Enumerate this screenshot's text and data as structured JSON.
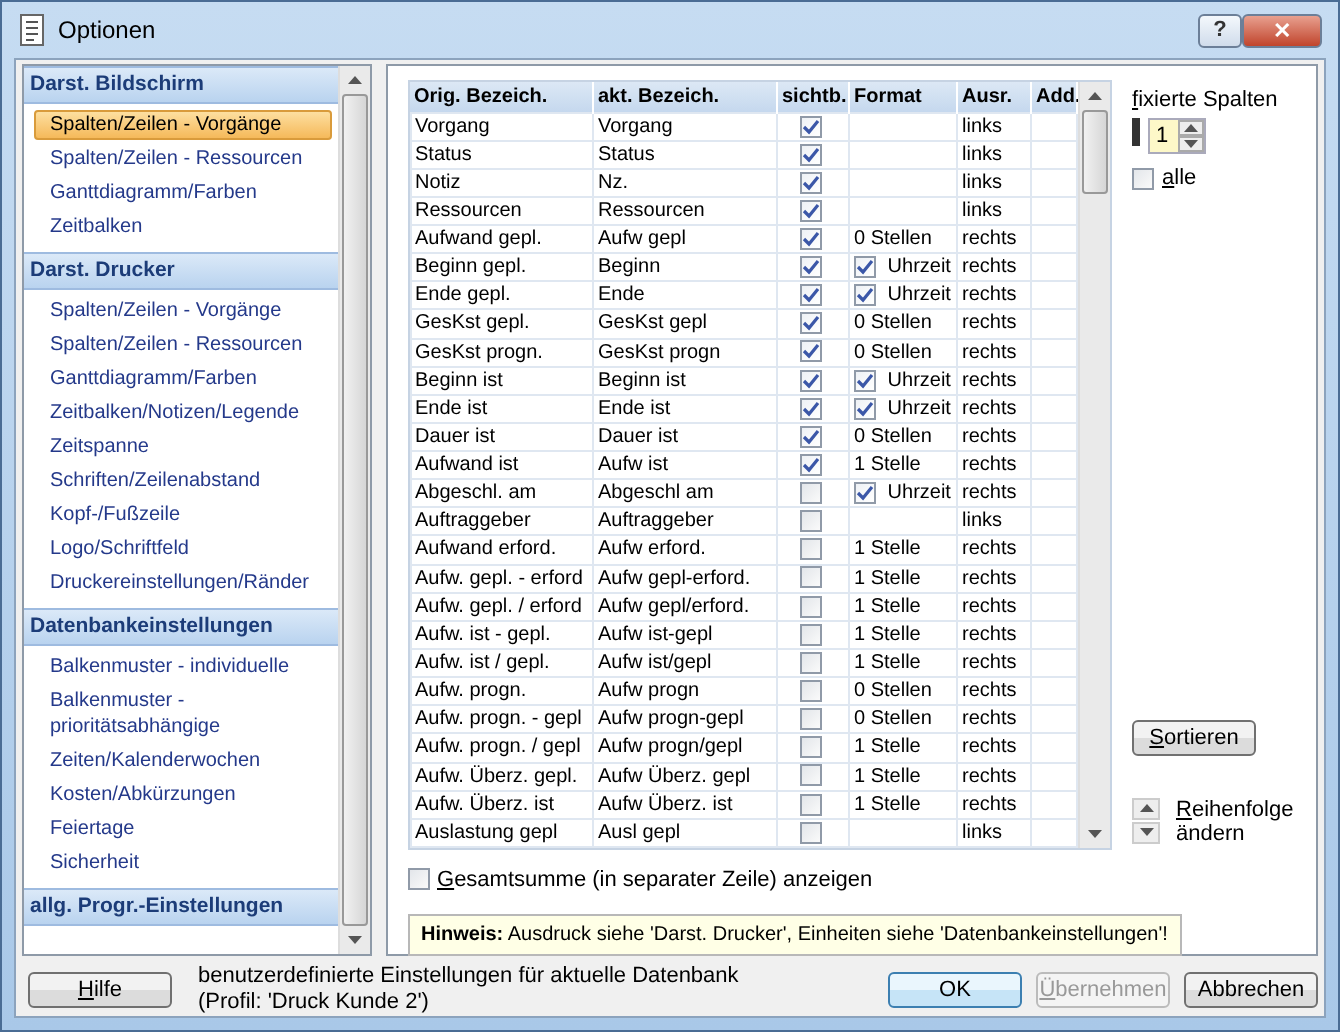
{
  "window": {
    "title": "Optionen",
    "help_button": "?",
    "close_button": "✕"
  },
  "sidebar": {
    "sections": [
      {
        "title": "Darst. Bildschirm",
        "items": [
          {
            "label": "Spalten/Zeilen - Vorgänge",
            "selected": true
          },
          {
            "label": "Spalten/Zeilen - Ressourcen",
            "selected": false
          },
          {
            "label": "Ganttdiagramm/Farben",
            "selected": false
          },
          {
            "label": "Zeitbalken",
            "selected": false
          }
        ]
      },
      {
        "title": "Darst. Drucker",
        "items": [
          {
            "label": "Spalten/Zeilen - Vorgänge",
            "selected": false
          },
          {
            "label": "Spalten/Zeilen - Ressourcen",
            "selected": false
          },
          {
            "label": "Ganttdiagramm/Farben",
            "selected": false
          },
          {
            "label": "Zeitbalken/Notizen/Legende",
            "selected": false
          },
          {
            "label": "Zeitspanne",
            "selected": false
          },
          {
            "label": "Schriften/Zeilenabstand",
            "selected": false
          },
          {
            "label": "Kopf-/Fußzeile",
            "selected": false
          },
          {
            "label": "Logo/Schriftfeld",
            "selected": false
          },
          {
            "label": "Druckereinstellungen/Ränder",
            "selected": false
          }
        ]
      },
      {
        "title": "Datenbankeinstellungen",
        "items": [
          {
            "label": "Balkenmuster - individuelle",
            "selected": false
          },
          {
            "label": "Balkenmuster - prioritätsabhängige",
            "selected": false
          },
          {
            "label": "Zeiten/Kalenderwochen",
            "selected": false
          },
          {
            "label": "Kosten/Abkürzungen",
            "selected": false
          },
          {
            "label": "Feiertage",
            "selected": false
          },
          {
            "label": "Sicherheit",
            "selected": false
          }
        ]
      },
      {
        "title": "allg. Progr.-Einstellungen"
      }
    ]
  },
  "table": {
    "columns": [
      "Orig. Bezeich.",
      "akt. Bezeich.",
      "sichtb.",
      "Format",
      "Ausr.",
      "Add."
    ],
    "rows": [
      {
        "orig": "Vorgang",
        "akt": "Vorgang",
        "visible": true,
        "align": "links"
      },
      {
        "orig": "Status",
        "akt": "Status",
        "visible": true,
        "align": "links"
      },
      {
        "orig": "Notiz",
        "akt": "Nz.",
        "visible": true,
        "align": "links"
      },
      {
        "orig": "Ressourcen",
        "akt": "Ressourcen",
        "visible": true,
        "align": "links"
      },
      {
        "orig": "Aufwand gepl.",
        "akt": "Aufw gepl",
        "visible": true,
        "format": "0 Stellen",
        "align": "rechts"
      },
      {
        "orig": "Beginn gepl.",
        "akt": "Beginn",
        "visible": true,
        "format": "Uhrzeit",
        "format_checked": true,
        "align": "rechts"
      },
      {
        "orig": "Ende gepl.",
        "akt": "Ende",
        "visible": true,
        "format": "Uhrzeit",
        "format_checked": true,
        "align": "rechts"
      },
      {
        "orig": "GesKst gepl.",
        "akt": "GesKst gepl",
        "visible": true,
        "format": "0 Stellen",
        "align": "rechts"
      },
      {
        "orig": "GesKst progn.",
        "akt": "GesKst progn",
        "visible": true,
        "format": "0 Stellen",
        "align": "rechts"
      },
      {
        "orig": "Beginn ist",
        "akt": "Beginn ist",
        "visible": true,
        "format": "Uhrzeit",
        "format_checked": true,
        "align": "rechts"
      },
      {
        "orig": "Ende ist",
        "akt": "Ende ist",
        "visible": true,
        "format": "Uhrzeit",
        "format_checked": true,
        "align": "rechts"
      },
      {
        "orig": "Dauer ist",
        "akt": "Dauer ist",
        "visible": true,
        "format": "0 Stellen",
        "align": "rechts"
      },
      {
        "orig": "Aufwand ist",
        "akt": "Aufw ist",
        "visible": true,
        "format": "1 Stelle",
        "align": "rechts"
      },
      {
        "orig": "Abgeschl. am",
        "akt": "Abgeschl am",
        "visible": false,
        "format": "Uhrzeit",
        "format_checked": true,
        "align": "rechts"
      },
      {
        "orig": "Auftraggeber",
        "akt": "Auftraggeber",
        "visible": false,
        "align": "links"
      },
      {
        "orig": "Aufwand erford.",
        "akt": "Aufw erford.",
        "visible": false,
        "format": "1 Stelle",
        "align": "rechts"
      },
      {
        "orig": "Aufw. gepl. - erford",
        "akt": "Aufw gepl-erford.",
        "visible": false,
        "format": "1 Stelle",
        "align": "rechts"
      },
      {
        "orig": "Aufw. gepl. / erford",
        "akt": "Aufw gepl/erford.",
        "visible": false,
        "format": "1 Stelle",
        "align": "rechts"
      },
      {
        "orig": "Aufw. ist - gepl.",
        "akt": "Aufw ist-gepl",
        "visible": false,
        "format": "1 Stelle",
        "align": "rechts"
      },
      {
        "orig": "Aufw. ist / gepl.",
        "akt": "Aufw ist/gepl",
        "visible": false,
        "format": "1 Stelle",
        "align": "rechts"
      },
      {
        "orig": "Aufw. progn.",
        "akt": "Aufw progn",
        "visible": false,
        "format": "0 Stellen",
        "align": "rechts"
      },
      {
        "orig": "Aufw. progn. - gepl",
        "akt": "Aufw progn-gepl",
        "visible": false,
        "format": "0 Stellen",
        "align": "rechts"
      },
      {
        "orig": "Aufw. progn. / gepl",
        "akt": "Aufw progn/gepl",
        "visible": false,
        "format": "1 Stelle",
        "align": "rechts"
      },
      {
        "orig": "Aufw. Überz. gepl.",
        "akt": "Aufw Überz. gepl",
        "visible": false,
        "format": "1 Stelle",
        "align": "rechts"
      },
      {
        "orig": "Aufw. Überz. ist",
        "akt": "Aufw Überz. ist",
        "visible": false,
        "format": "1 Stelle",
        "align": "rechts"
      },
      {
        "orig": "Auslastung gepl",
        "akt": "Ausl gepl",
        "visible": false,
        "align": "links"
      }
    ]
  },
  "fixed_columns": {
    "label": "fixierte Spalten",
    "mnemonic": true,
    "value": "1",
    "all": {
      "label": "alle",
      "mnemonic": true,
      "checked": false
    }
  },
  "sort_button": {
    "label": "Sortieren",
    "mnemonic": true
  },
  "reorder": {
    "label": "Reihenfolge ändern",
    "mnemonic": true
  },
  "total_checkbox": {
    "label": "Gesamtsumme (in separater Zeile) anzeigen",
    "mnemonic": true,
    "checked": false
  },
  "hint": {
    "text": "**Hinweis:**  Ausdruck siehe 'Darst. Drucker', Einheiten siehe 'Datenbankeinstellungen'!"
  },
  "footer": {
    "help_button": {
      "label": "Hilfe",
      "mnemonic": true
    },
    "info": "benutzerdefinierte Einstellungen für aktuelle Datenbank",
    "profile": "(Profil: 'Druck Kunde 2')",
    "buttons": [
      {
        "label": "OK",
        "disabled": false,
        "mnemonic": false
      },
      {
        "label": "Übernehmen",
        "disabled": true,
        "mnemonic": true
      },
      {
        "label": "Abbrechen",
        "disabled": false,
        "mnemonic": false
      }
    ]
  }
}
